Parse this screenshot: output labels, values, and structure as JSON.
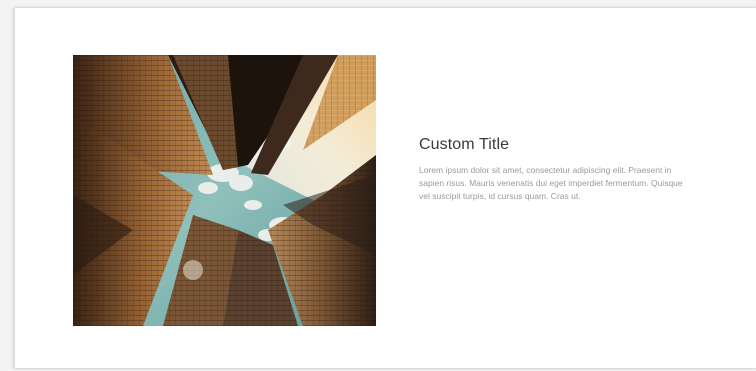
{
  "slide": {
    "title": "Custom Title",
    "body": "Lorem ipsum dolor sit amet, consectetur adipiscing elit. Praesent in sapien risus. Mauris venenatis dui eget imperdiet fermentum. Quisque vel suscipit turpis, id cursus quam. Cras ut."
  },
  "image": {
    "subject": "skyscrapers-looking-up",
    "colors": {
      "sky": "#5f9e9c",
      "building_warm": "#8a5a32",
      "building_dark": "#2a1c14",
      "cloud": "#e8ecea"
    }
  }
}
